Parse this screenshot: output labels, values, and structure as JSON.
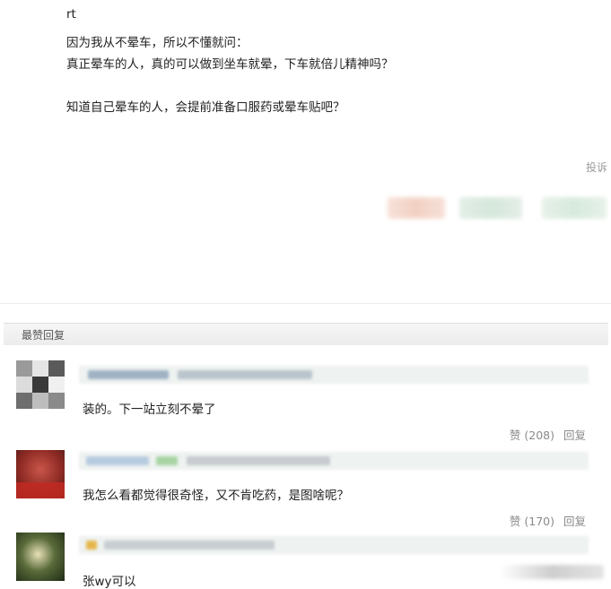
{
  "post": {
    "lines": [
      "rt",
      "因为我从不晕车，所以不懂就问：",
      "真正晕车的人，真的可以做到坐车就晕，下车就倍儿精神吗？",
      "知道自己晕车的人，会提前准备口服药或晕车贴吧？"
    ],
    "report_label": "投诉"
  },
  "section": {
    "title": "最赞回复"
  },
  "replies": [
    {
      "text": "装的。下一站立刻不晕了",
      "like_label": "赞 (208)",
      "reply_label": "回复"
    },
    {
      "text": "我怎么看都觉得很奇怪，又不肯吃药，是图啥呢？",
      "like_label": "赞 (170)",
      "reply_label": "回复"
    },
    {
      "text": "张wy可以"
    }
  ],
  "colors": {
    "text": "#222222",
    "muted": "#8a8a8a",
    "header_bg": "#eeeeee"
  }
}
